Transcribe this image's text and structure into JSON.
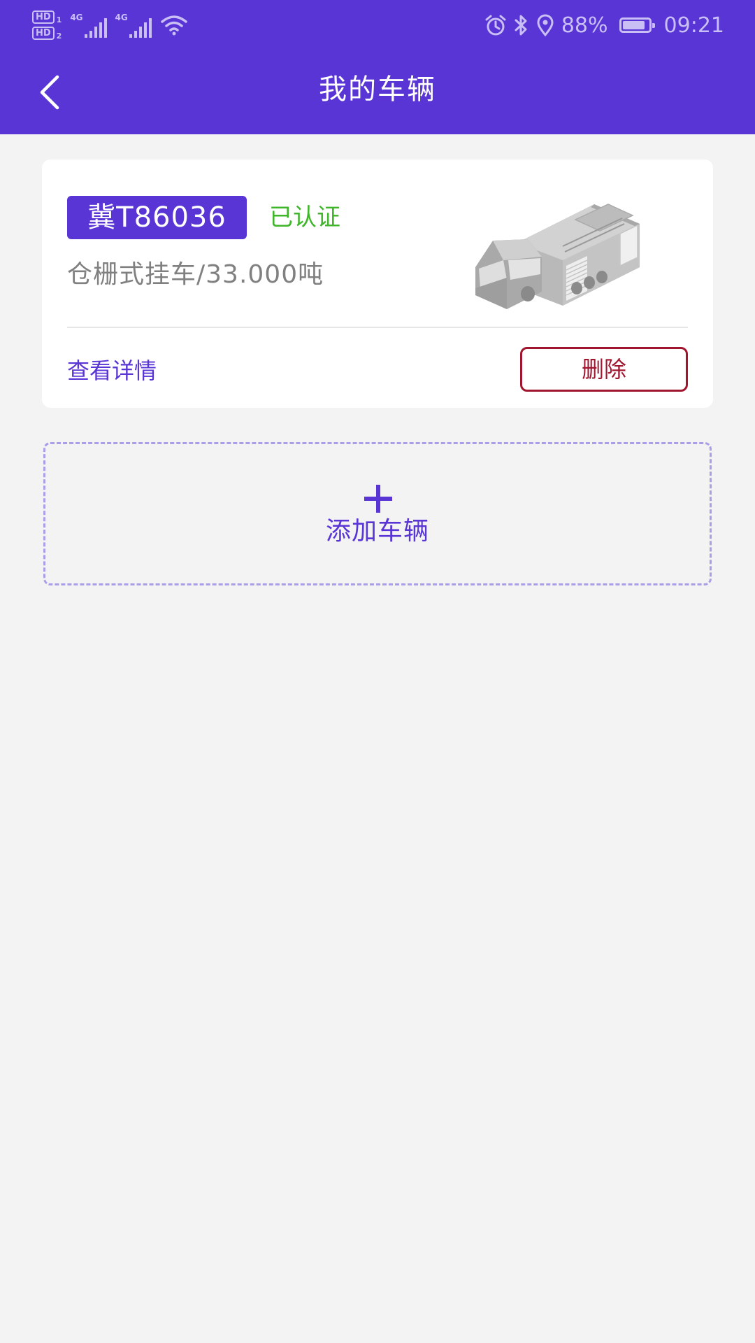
{
  "status_bar": {
    "sim1_label": "HD",
    "sim1_index": "1",
    "sim2_label": "HD",
    "sim2_index": "2",
    "network1": "4G",
    "network2": "4G",
    "battery_percent": "88%",
    "battery_level": 0.88,
    "time": "09:21",
    "icons": [
      "alarm-icon",
      "bluetooth-icon",
      "location-icon",
      "wifi-icon",
      "signal-icon"
    ]
  },
  "header": {
    "title": "我的车辆",
    "back_icon": "back-chevron-icon"
  },
  "vehicles": [
    {
      "plate": "冀T86036",
      "status": "已认证",
      "description": "仓栅式挂车/33.000吨",
      "details_label": "查看详情",
      "delete_label": "删除"
    }
  ],
  "add_vehicle": {
    "label": "添加车辆",
    "icon": "plus-icon"
  },
  "colors": {
    "primary": "#5835d4",
    "background": "#f3f3f3",
    "certified": "#3fb52a",
    "delete": "#a0162e",
    "dashed_border": "#aa9ee8"
  }
}
